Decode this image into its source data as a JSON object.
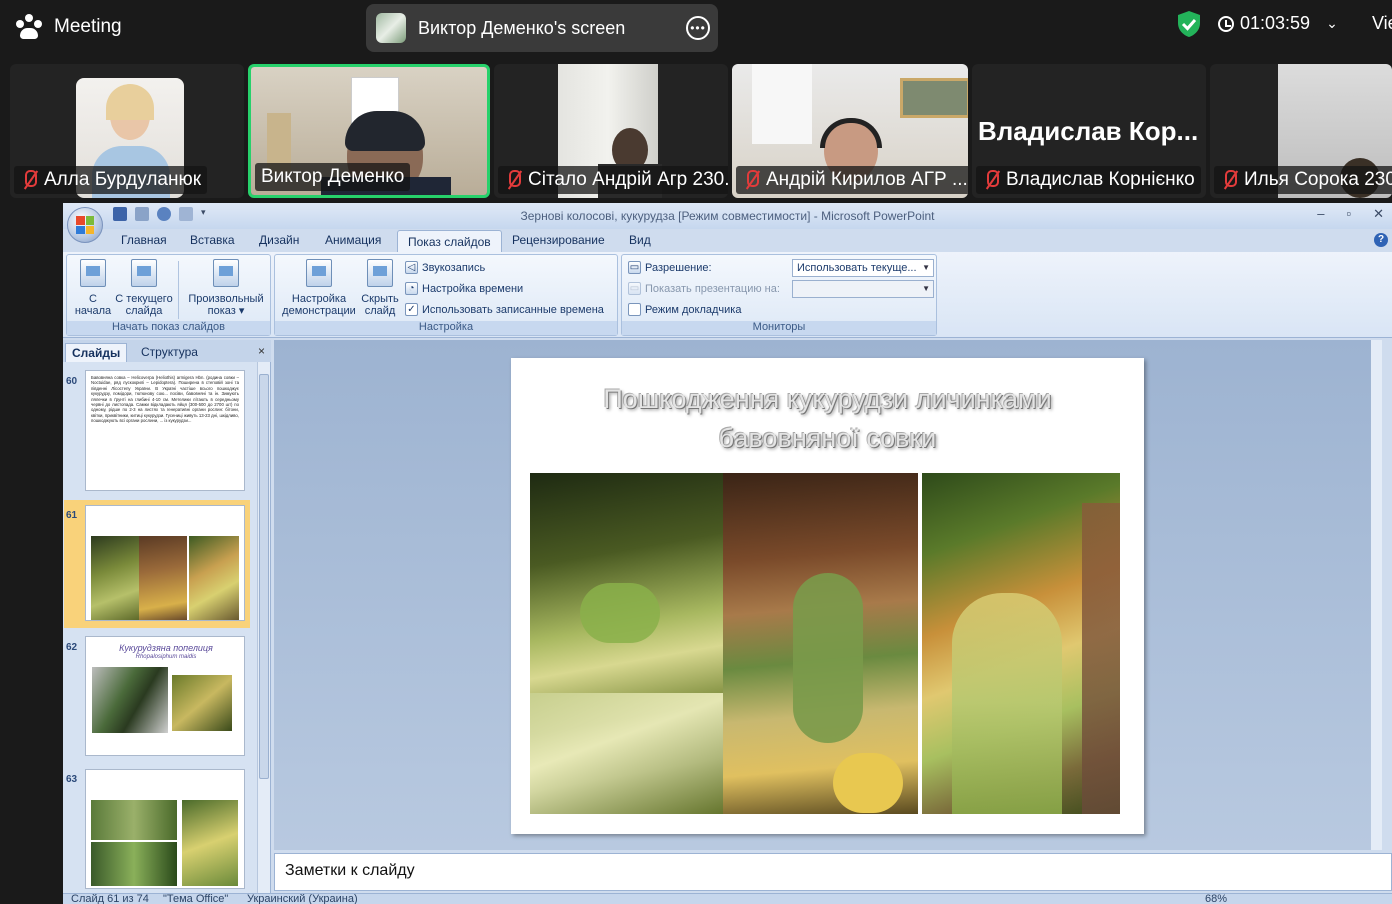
{
  "zoom": {
    "meeting_label": "Meeting",
    "share_label": "Виктор Деменко's screen",
    "timer": "01:03:59",
    "view_label": "Vie",
    "participants": [
      {
        "name": "Алла Бурдуланюк",
        "muted": true
      },
      {
        "name": "Виктор Деменко",
        "muted": false,
        "active": true
      },
      {
        "name": "Сітало Андрій Агр 230...",
        "muted": true
      },
      {
        "name": "Андрій Кирилов АГР ...",
        "muted": true
      },
      {
        "name": "Владислав Корнієнко",
        "muted": true,
        "big_label": "Владислав  Кор..."
      },
      {
        "name": "Илья Сорока 230",
        "muted": true
      }
    ]
  },
  "ppt": {
    "window_title": "Зернові колосові, кукурудза [Режим совместимости] - Microsoft PowerPoint",
    "tabs": [
      "Главная",
      "Вставка",
      "Дизайн",
      "Анимация",
      "Показ слайдов",
      "Рецензирование",
      "Вид"
    ],
    "ribbon": {
      "start_group_label": "Начать показ слайдов",
      "btn_from_start": [
        "С",
        "начала"
      ],
      "btn_from_current": [
        "С текущего",
        "слайда"
      ],
      "btn_custom": [
        "Произвольный",
        "показ ▾"
      ],
      "setup_group_label": "Настройка",
      "btn_setup": [
        "Настройка",
        "демонстрации"
      ],
      "btn_hide": [
        "Скрыть",
        "слайд"
      ],
      "sound_record": "Звукозапись",
      "rehearse": "Настройка времени",
      "use_timings": "Использовать записанные времена",
      "monitors_group_label": "Мониторы",
      "resolution_label": "Разрешение:",
      "resolution_value": "Использовать текуще...",
      "show_on_label": "Показать презентацию на:",
      "presenter_view": "Режим докладчика"
    },
    "pane": {
      "tab_slides": "Слайды",
      "tab_outline": "Структура",
      "close": "×",
      "thumbs": [
        {
          "num": "60",
          "text": "Бавовняна совка – Helicoverpa (Heliothis) armigera Hbn. (родина совки – Noctuidae, ряд лускокрилі – Lepidoptera). Поширена в степовій зоні та південні Лісостепу України. В Україні частіше всього пошкоджує кукурудзу, помідори, тютюнову сою... посіви, бавовняні та ін. Зимують лялечки в ґрунті на глибині 4-10 см. Метелики літають в середньому червні до листопада. Самки відкладають яйця (300-500 до 2700 шт) по одному, рідше по 2-3 на листях та генеративні органи рослин: бітони, квітки, приквітники, китиці кукурудзи. Гусениці живуть 13-23 дні, шкідливо, пошкоджують всі органи рослини, ... із кукурудзи..."
        },
        {
          "num": "61"
        },
        {
          "num": "62",
          "title": "Кукурудзяна попелиця",
          "subtitle": "Rhopalosiphum maidis"
        },
        {
          "num": "63"
        }
      ]
    },
    "slide": {
      "title_line1": "Пошкодження кукурудзи личинками",
      "title_line2": "бавовняної совки"
    },
    "notes_placeholder": "Заметки к слайду",
    "status": {
      "slide_info": "Слайд 61 из 74",
      "theme": "\"Тема Office\"",
      "language": "Украинский (Украина)",
      "zoom": "68%"
    }
  },
  "colors": {
    "zoom_bg": "#1a1a1a",
    "active_speaker": "#27d16b",
    "mute_red": "#e23b3b",
    "ribbon_blue": "#cfdcee",
    "thumb_selected": "#f9c85a"
  }
}
